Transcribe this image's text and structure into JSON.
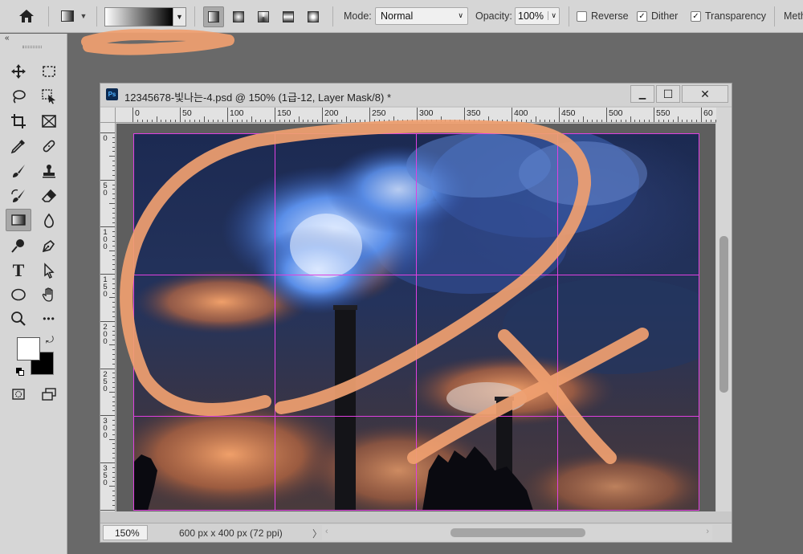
{
  "options_bar": {
    "mode_label": "Mode:",
    "mode_value": "Normal",
    "opacity_label": "Opacity:",
    "opacity_value": "100%",
    "reverse_label": "Reverse",
    "reverse_checked": false,
    "dither_label": "Dither",
    "dither_checked": true,
    "transparency_label": "Transparency",
    "transparency_checked": true,
    "method_label": "Meth"
  },
  "toolbar": {
    "collapse_glyph": "«",
    "tools": [
      {
        "name": "move-tool",
        "icon": "move-icon"
      },
      {
        "name": "marquee-tool",
        "icon": "marquee-icon"
      },
      {
        "name": "lasso-tool",
        "icon": "lasso-icon"
      },
      {
        "name": "object-select-tool",
        "icon": "object-select-icon"
      },
      {
        "name": "crop-tool",
        "icon": "crop-icon"
      },
      {
        "name": "frame-tool",
        "icon": "frame-icon"
      },
      {
        "name": "eyedropper-tool",
        "icon": "eyedropper-icon"
      },
      {
        "name": "healing-tool",
        "icon": "bandage-icon"
      },
      {
        "name": "brush-tool",
        "icon": "brush-icon"
      },
      {
        "name": "stamp-tool",
        "icon": "stamp-icon"
      },
      {
        "name": "history-brush-tool",
        "icon": "history-brush-icon"
      },
      {
        "name": "eraser-tool",
        "icon": "eraser-icon"
      },
      {
        "name": "gradient-tool",
        "icon": "gradient-icon",
        "active": true
      },
      {
        "name": "blur-tool",
        "icon": "drop-icon"
      },
      {
        "name": "dodge-tool",
        "icon": "dodge-icon"
      },
      {
        "name": "pen-tool",
        "icon": "pen-icon"
      },
      {
        "name": "type-tool",
        "icon": "type-icon"
      },
      {
        "name": "path-select-tool",
        "icon": "arrow-icon"
      },
      {
        "name": "ellipse-tool",
        "icon": "ellipse-icon"
      },
      {
        "name": "hand-tool",
        "icon": "hand-icon"
      },
      {
        "name": "zoom-tool",
        "icon": "zoom-icon"
      },
      {
        "name": "more-tools",
        "icon": "ellipsis-icon"
      }
    ],
    "type_glyph": "T",
    "more_glyph": "•••",
    "foreground_color": "#ffffff",
    "background_color": "#000000"
  },
  "document": {
    "title": "12345678-빛나는-4.psd @ 150% (1급-12, Layer Mask/8) *",
    "ps_badge": "Ps",
    "minimize_glyph": "▁",
    "maximize_glyph": "☐",
    "close_glyph": "✕",
    "ruler_h_labels": [
      "0",
      "50",
      "100",
      "150",
      "200",
      "250",
      "300",
      "350",
      "400",
      "450",
      "500",
      "550",
      "60"
    ],
    "ruler_v_labels": [
      "0",
      "50",
      "100",
      "150",
      "200",
      "250",
      "300",
      "350",
      "4"
    ],
    "zoom": "150%",
    "size_info": "600 px x 400 px (72 ppi)",
    "status_arrow": "〉",
    "scroll_left": "‹",
    "scroll_right": "›"
  },
  "colors": {
    "guide": "#e040e0",
    "marker": "#f0a070",
    "sky_dark": "#1a2440",
    "smoke_blue": "#4a86e0"
  }
}
